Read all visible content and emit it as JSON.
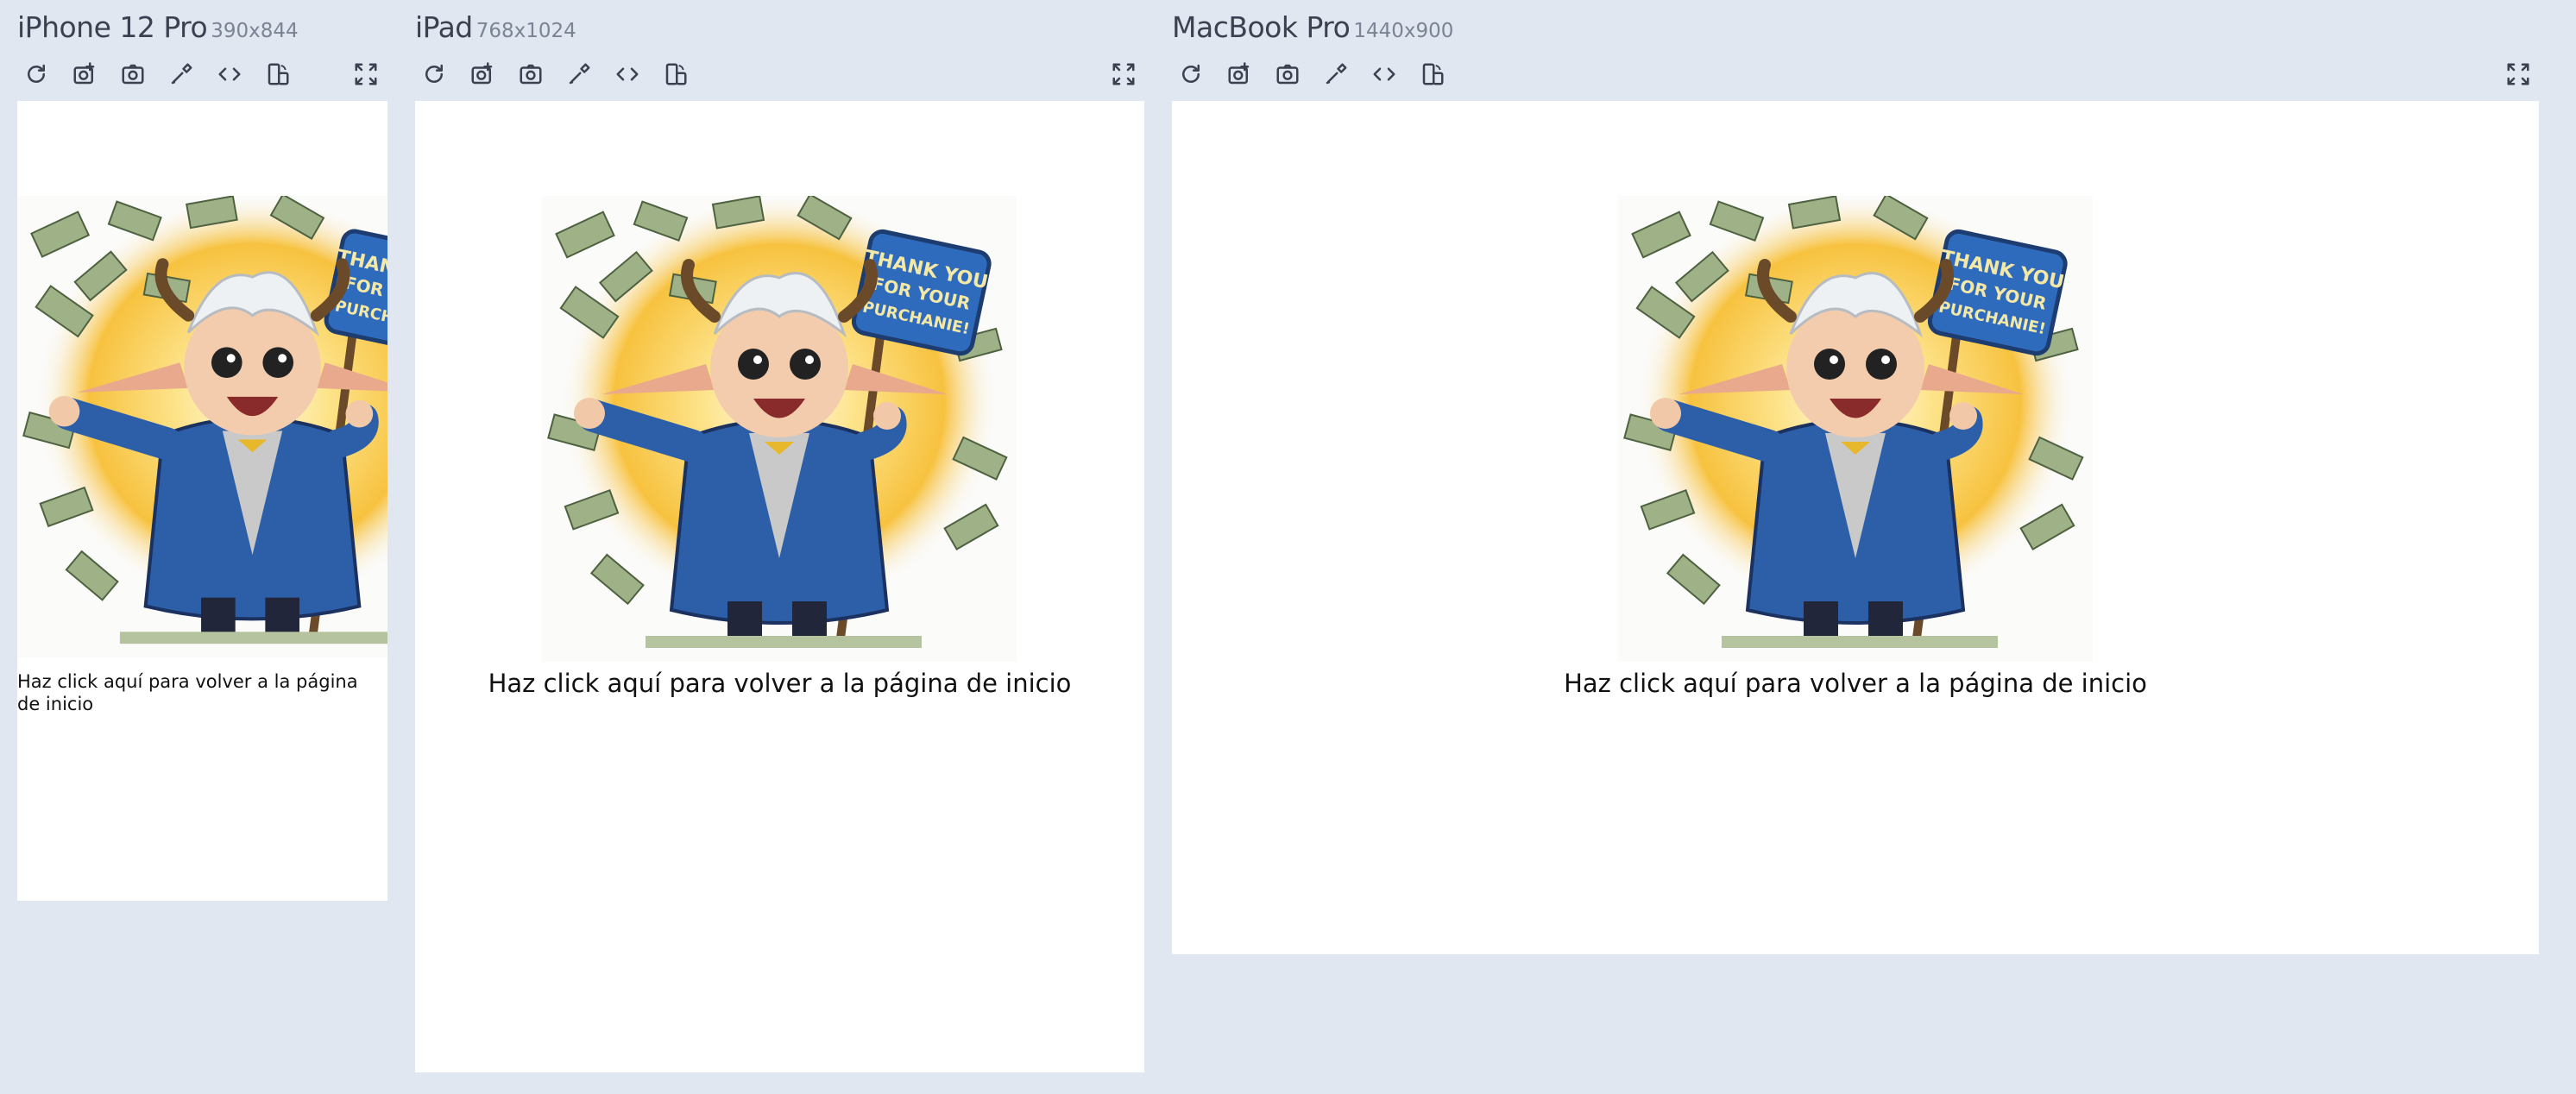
{
  "devices": [
    {
      "name": "iPhone 12 Pro",
      "size": "390x844"
    },
    {
      "name": "iPad",
      "size": "768x1024"
    },
    {
      "name": "MacBook Pro",
      "size": "1440x900"
    }
  ],
  "page": {
    "image_sign_text": "THANK YOU FOR YOUR PURCHANIE!",
    "link_text": "Haz click aquí para volver a la página de inicio"
  },
  "toolbar_icons": [
    "refresh-icon",
    "screenshot-full-icon",
    "screenshot-icon",
    "eyedropper-icon",
    "code-icon",
    "rotate-icon",
    "fullscreen-icon"
  ],
  "colors": {
    "background": "#e1e7f0",
    "screen": "#ffffff",
    "icon": "#3a4150"
  }
}
